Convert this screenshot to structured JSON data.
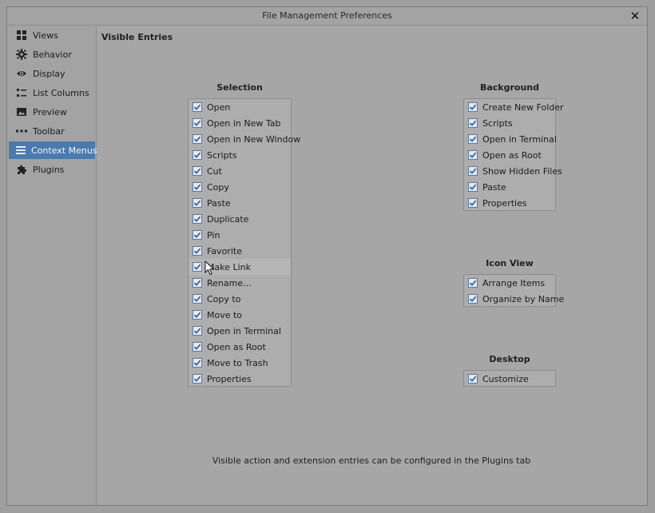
{
  "window": {
    "title": "File Management Preferences"
  },
  "sidebar": {
    "items": [
      {
        "label": "Views",
        "icon": "grid-icon"
      },
      {
        "label": "Behavior",
        "icon": "gear-icon"
      },
      {
        "label": "Display",
        "icon": "eye-icon"
      },
      {
        "label": "List Columns",
        "icon": "columns-icon"
      },
      {
        "label": "Preview",
        "icon": "image-icon"
      },
      {
        "label": "Toolbar",
        "icon": "dots-icon"
      },
      {
        "label": "Context Menus",
        "icon": "menu-icon",
        "selected": true
      },
      {
        "label": "Plugins",
        "icon": "puzzle-icon"
      }
    ]
  },
  "main": {
    "section_title": "Visible Entries",
    "groups": {
      "selection": {
        "title": "Selection",
        "items": [
          "Open",
          "Open in New Tab",
          "Open in New Window",
          "Scripts",
          "Cut",
          "Copy",
          "Paste",
          "Duplicate",
          "Pin",
          "Favorite",
          "Make Link",
          "Rename...",
          "Copy to",
          "Move to",
          "Open in Terminal",
          "Open as Root",
          "Move to Trash",
          "Properties"
        ]
      },
      "background": {
        "title": "Background",
        "items": [
          "Create New Folder",
          "Scripts",
          "Open in Terminal",
          "Open as Root",
          "Show Hidden Files",
          "Paste",
          "Properties"
        ]
      },
      "icon_view": {
        "title": "Icon View",
        "items": [
          "Arrange Items",
          "Organize by Name"
        ]
      },
      "desktop": {
        "title": "Desktop",
        "items": [
          "Customize"
        ]
      }
    },
    "footer": "Visible action and extension entries can be configured in the Plugins tab"
  },
  "colors": {
    "accent": "#4a7ab0",
    "checkbox_border": "#4d7bb3"
  }
}
